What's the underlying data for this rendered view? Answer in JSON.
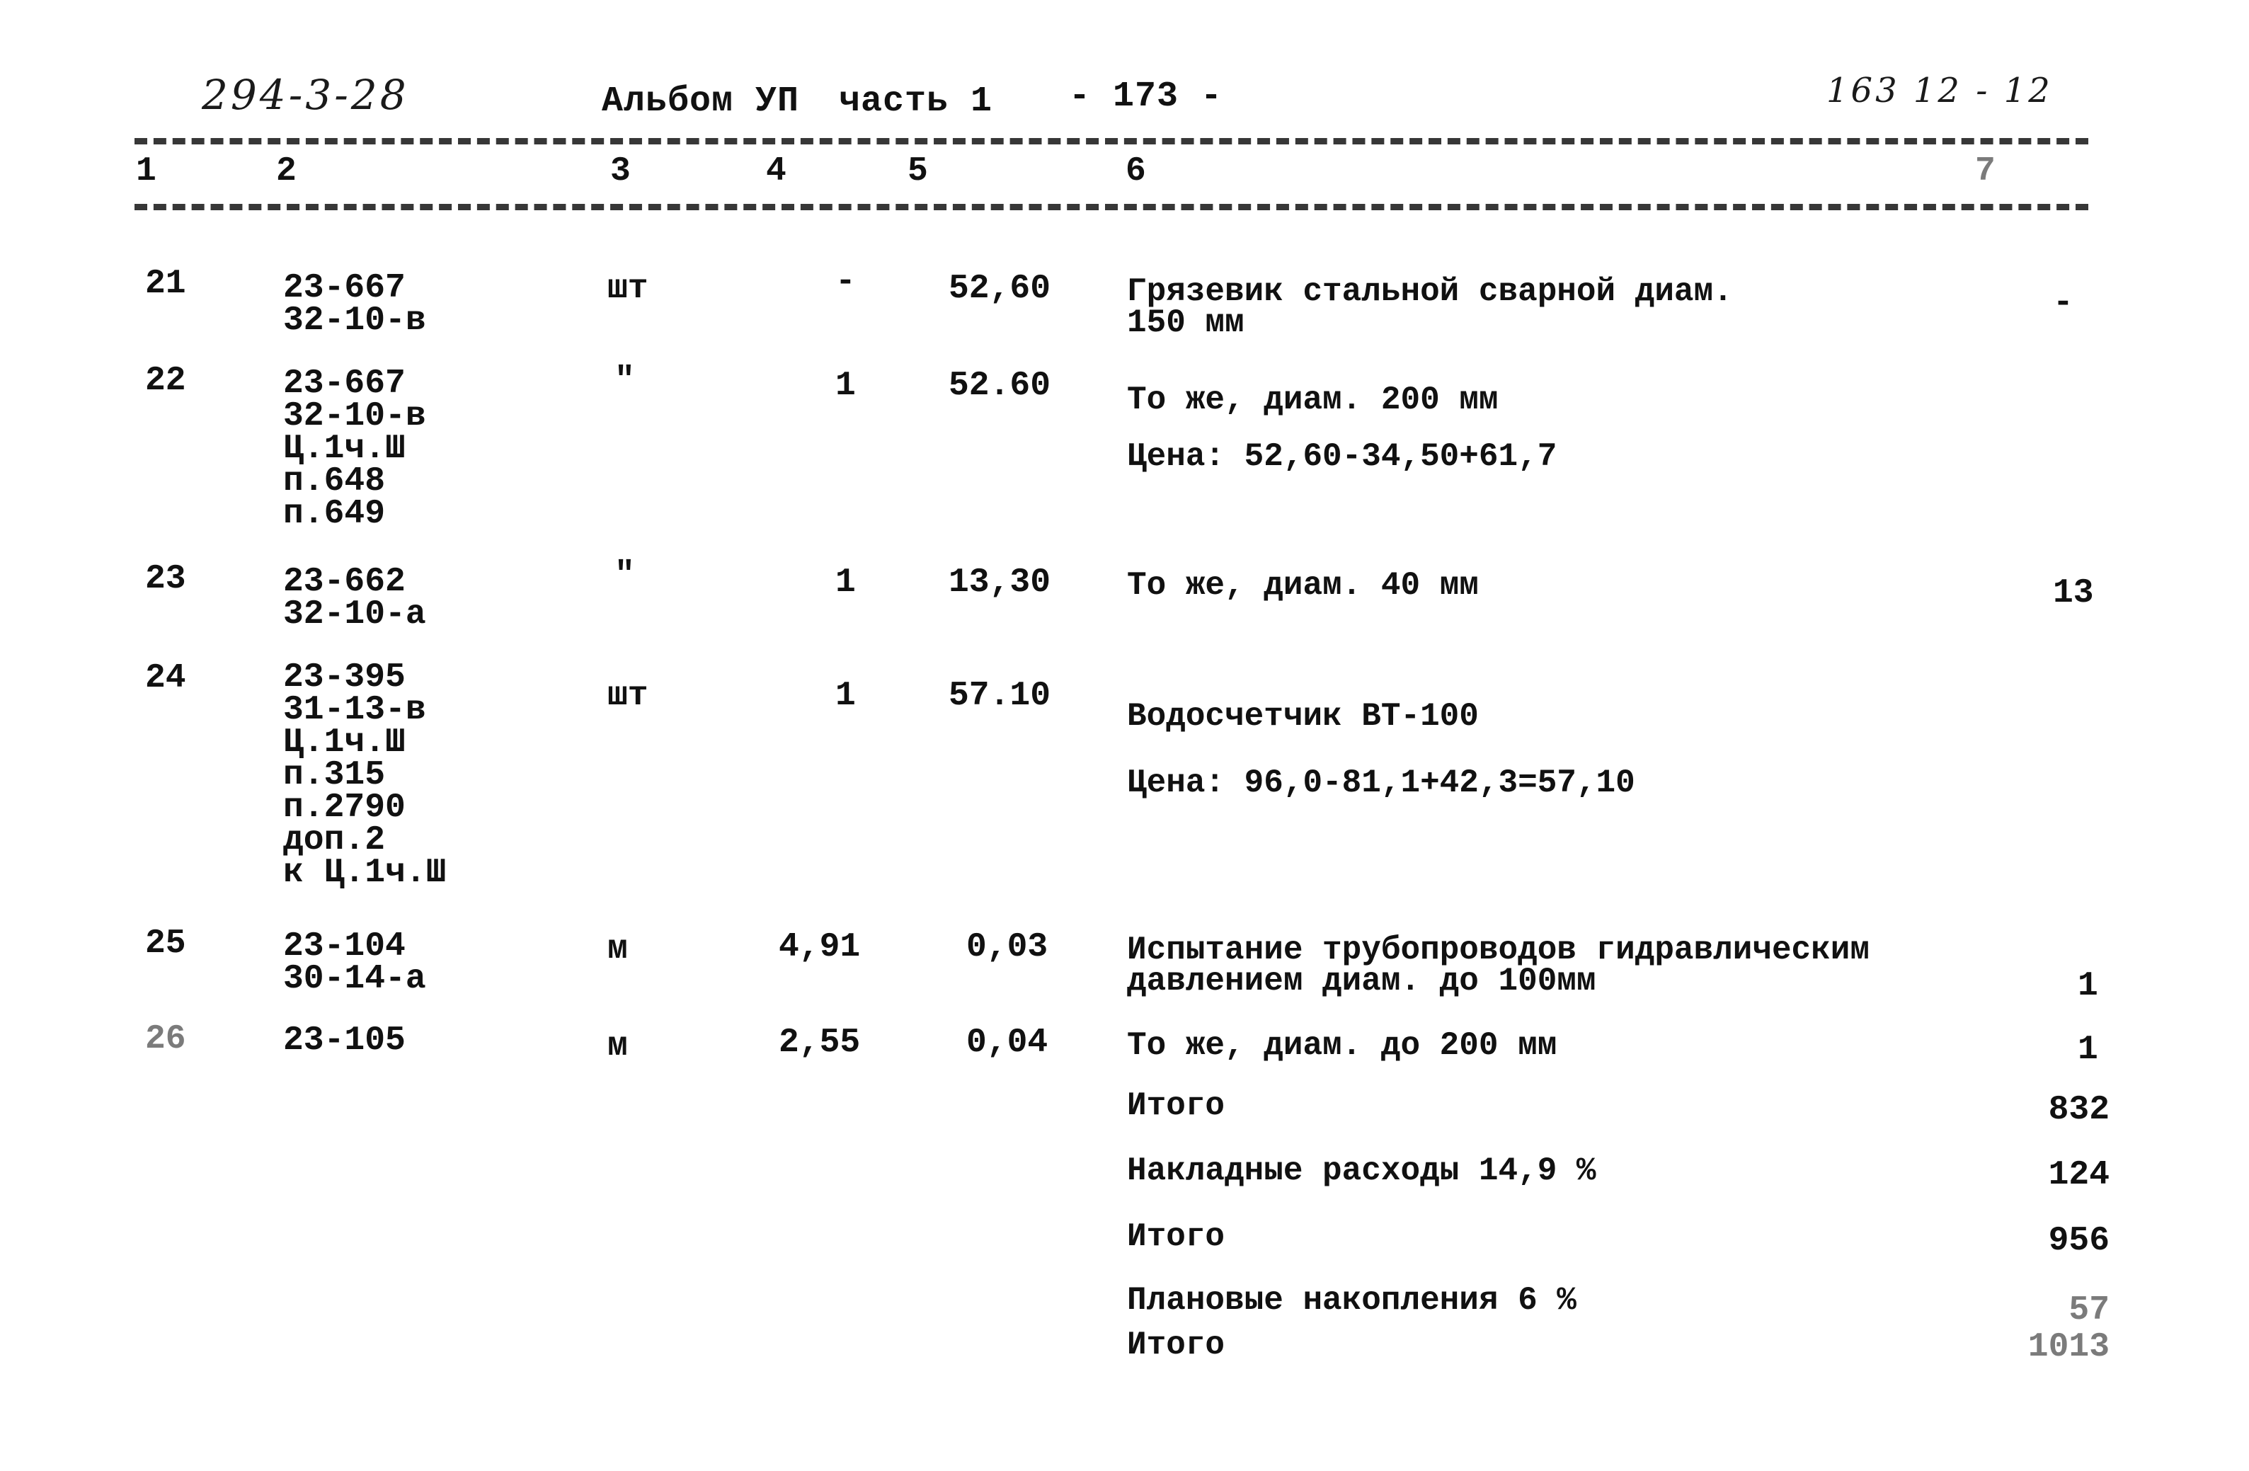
{
  "header": {
    "doc_code": "294-3-28",
    "album": "Альбом УП",
    "part": "часть 1",
    "page": "- 173 -",
    "stamp": "163 12 - 12"
  },
  "columns": [
    "1",
    "2",
    "3",
    "4",
    "5",
    "6",
    "7"
  ],
  "rows": [
    {
      "num": "21",
      "refs": [
        "23-667",
        "32-10-в"
      ],
      "unit": "шт",
      "qty": "-",
      "price": "52,60",
      "desc": [
        "Грязевик стальной сварной диам.",
        "150 мм"
      ],
      "total": "-"
    },
    {
      "num": "22",
      "refs": [
        "23-667",
        "32-10-в",
        "Ц.1ч.Ш",
        "п.648",
        "п.649"
      ],
      "unit": "\"",
      "qty": "1",
      "price": "52.60",
      "desc": [
        "То же, диам. 200 мм",
        "Цена: 52,60-34,50+61,7"
      ],
      "total": ""
    },
    {
      "num": "23",
      "refs": [
        "23-662",
        "32-10-а"
      ],
      "unit": "\"",
      "qty": "1",
      "price": "13,30",
      "desc": [
        "То же, диам. 40 мм"
      ],
      "total": "13"
    },
    {
      "num": "24",
      "refs": [
        "23-395",
        "31-13-в",
        "Ц.1ч.Ш",
        "п.315",
        "п.2790",
        "доп.2",
        "к Ц.1ч.Ш"
      ],
      "unit": "шт",
      "qty": "1",
      "price": "57.10",
      "desc": [
        "Водосчетчик ВТ-100",
        "Цена: 96,0-81,1+42,3=57,10"
      ],
      "total": ""
    },
    {
      "num": "25",
      "refs": [
        "23-104",
        "30-14-а"
      ],
      "unit": "м",
      "qty": "4,91",
      "price": "0,03",
      "desc": [
        "Испытание трубопроводов гидравлическим",
        "давлением диам. до 100мм"
      ],
      "total": "1"
    },
    {
      "num": "26",
      "refs": [
        "23-105"
      ],
      "unit": "м",
      "qty": "2,55",
      "price": "0,04",
      "desc": [
        "То же, диам. до 200 мм"
      ],
      "total": "1"
    }
  ],
  "summary": [
    {
      "label": "Итого",
      "value": "832"
    },
    {
      "label": "Накладные расходы 14,9 %",
      "value": "124"
    },
    {
      "label": "Итого",
      "value": "956"
    },
    {
      "label": "Плановые накопления 6 %",
      "value": "57"
    },
    {
      "label": "Итого",
      "value": "1013"
    }
  ]
}
